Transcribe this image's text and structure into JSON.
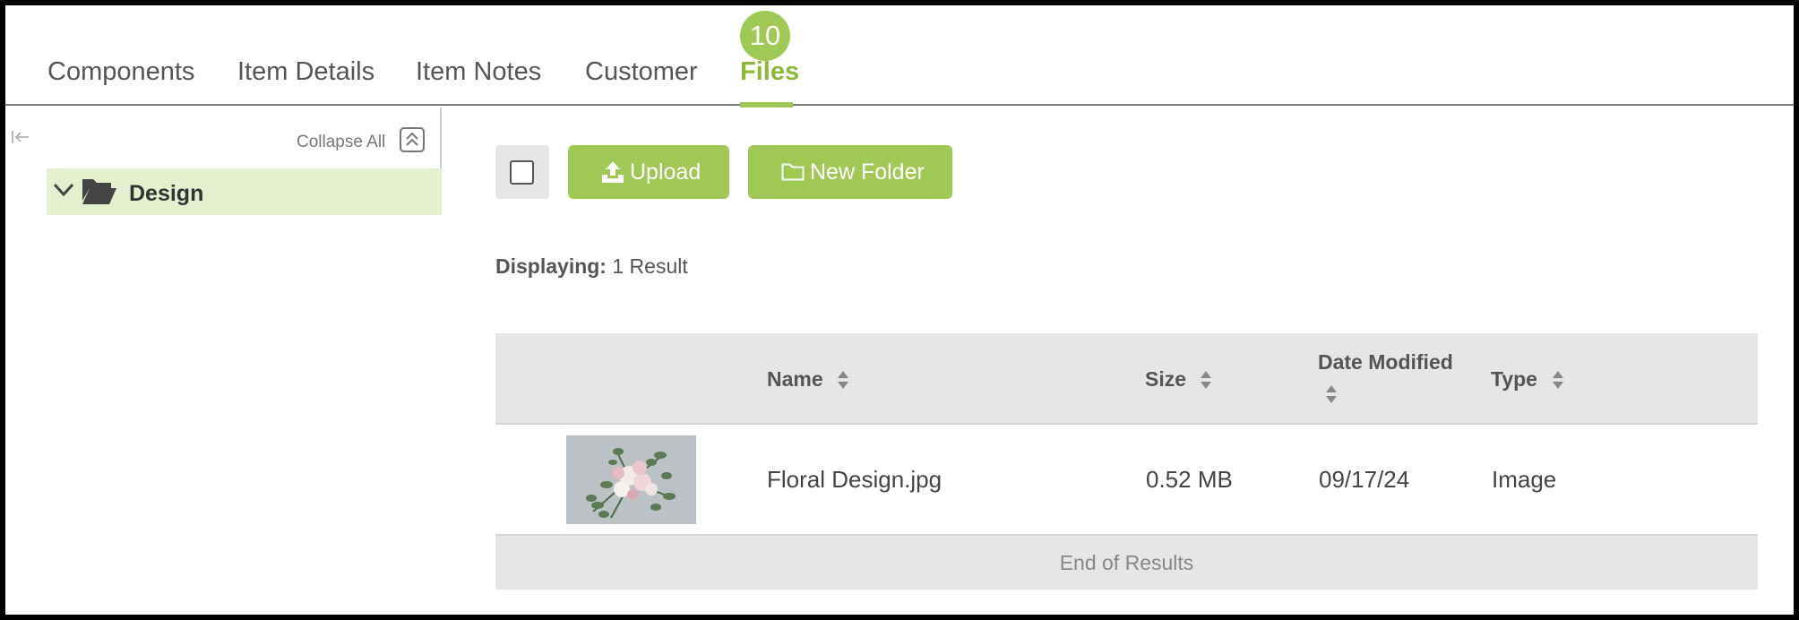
{
  "tabs": [
    {
      "label": "Components"
    },
    {
      "label": "Item Details"
    },
    {
      "label": "Item Notes"
    },
    {
      "label": "Customer"
    },
    {
      "label": "Files",
      "badge": "10",
      "active": true
    }
  ],
  "sidebar": {
    "collapse_all_label": "Collapse All",
    "tree": [
      {
        "label": "Design",
        "icon": "folder-open-icon",
        "expanded": true,
        "selected": true
      }
    ]
  },
  "toolbar": {
    "upload_label": "Upload",
    "new_folder_label": "New Folder"
  },
  "results": {
    "prefix": "Displaying:",
    "count_text": "1 Result"
  },
  "table": {
    "columns": [
      "Name",
      "Size",
      "Date Modified",
      "Type"
    ],
    "rows": [
      {
        "name": "Floral Design.jpg",
        "size": "0.52 MB",
        "date_modified": "09/17/24",
        "type": "Image",
        "thumbnail": "floral-bouquet-thumbnail"
      }
    ],
    "footer": "End of Results"
  },
  "colors": {
    "accent": "#a0c855",
    "accent_text": "#8cb83a",
    "tree_selected_bg": "#e3efcf",
    "header_bg": "#e6e6e6"
  }
}
